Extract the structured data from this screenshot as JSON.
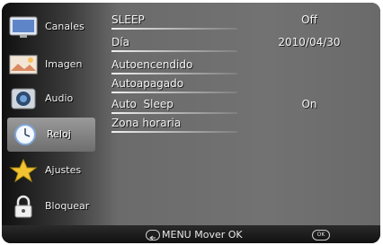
{
  "sidebar": {
    "items": [
      {
        "label": "Canales",
        "icon": "tv-screen-icon"
      },
      {
        "label": "Imagen",
        "icon": "landscape-picture-icon"
      },
      {
        "label": "Audio",
        "icon": "speaker-icon"
      },
      {
        "label": "Reloj",
        "icon": "clock-icon",
        "active": true
      },
      {
        "label": "Ajustes",
        "icon": "star-icon"
      },
      {
        "label": "Bloquear",
        "icon": "padlock-icon"
      }
    ]
  },
  "menu": {
    "rows": [
      {
        "label": "SLEEP",
        "value": "Off"
      },
      {
        "label": "Día",
        "value": "2010/04/30"
      },
      {
        "label": "Autoencendido",
        "value": ""
      },
      {
        "label": "Autoapagado",
        "value": ""
      },
      {
        "label": "Auto  Sleep",
        "value": "On"
      },
      {
        "label": "Zona horaria",
        "value": ""
      }
    ]
  },
  "footer": {
    "hint": "MENU Mover OK",
    "ok_label": "OK"
  },
  "colors": {
    "sidebar_bg": "#2a2a2a",
    "panel_bg": "#707070",
    "active_item": "#8a8a8a",
    "text": "#f4f4f4"
  }
}
